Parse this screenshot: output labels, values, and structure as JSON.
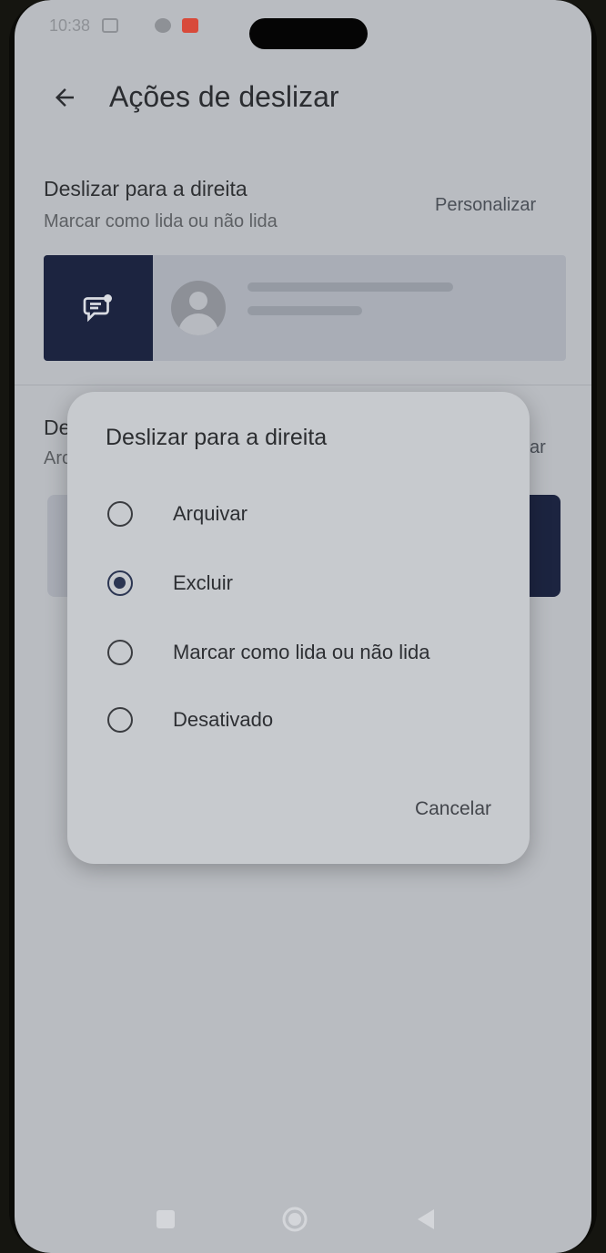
{
  "status_bar": {
    "time": "10:38",
    "notification_color": "#d84a3a"
  },
  "header": {
    "back_icon": "arrow-left-icon",
    "title": "Ações de deslizar"
  },
  "swipe_right": {
    "title": "Deslizar para a direita",
    "action": "Marcar como lida ou não lida",
    "customize_label": "Personalizar",
    "preview_action_icon": "mark-read-icon"
  },
  "swipe_left": {
    "title_partial": "De",
    "action_partial": "Arc",
    "customize_partial": "ar"
  },
  "dialog": {
    "title": "Deslizar para a direita",
    "options": [
      {
        "label": "Arquivar",
        "selected": false
      },
      {
        "label": "Excluir",
        "selected": true
      },
      {
        "label": "Marcar como lida ou não lida",
        "selected": false
      },
      {
        "label": "Desativado",
        "selected": false
      }
    ],
    "cancel_label": "Cancelar"
  },
  "nav_bar": {
    "recents_icon": "square-recents-icon",
    "home_icon": "circle-home-icon",
    "back_icon": "triangle-back-icon"
  },
  "colors": {
    "accent": "#1c2440",
    "dialog_bg": "#c7cace",
    "screen_bg": "#b9bcc1"
  }
}
